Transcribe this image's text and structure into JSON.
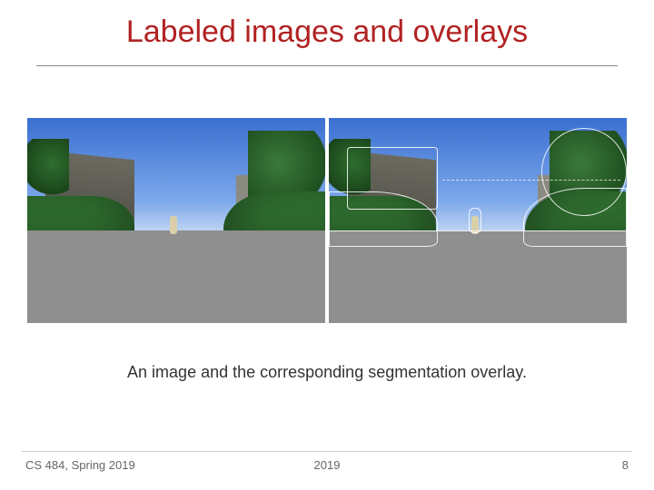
{
  "title": "Labeled images and overlays",
  "caption": "An image and the corresponding segmentation overlay.",
  "footer": {
    "left": "CS 484, Spring 2019",
    "center": "2019",
    "right": "8"
  }
}
